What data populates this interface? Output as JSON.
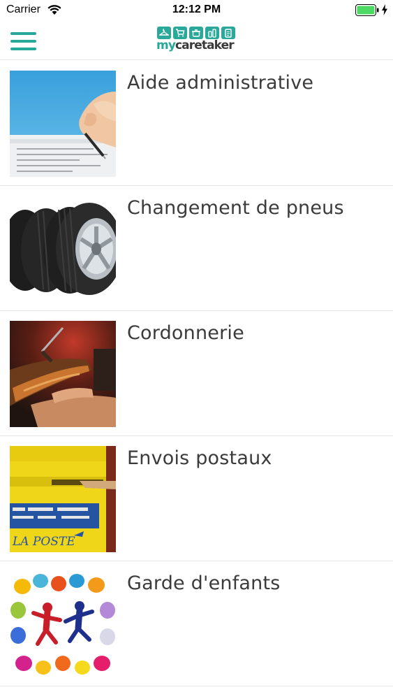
{
  "status_bar": {
    "carrier": "Carrier",
    "time": "12:12 PM",
    "wifi_icon": "wifi-icon",
    "battery_icon": "battery-icon",
    "charging_icon": "charging-bolt-icon",
    "battery_color": "#4cd964"
  },
  "nav": {
    "menu_icon": "hamburger-menu-icon",
    "logo": {
      "text_my": "my",
      "text_caretaker": "caretaker",
      "icons": [
        "hanger-icon",
        "cart-icon",
        "pot-icon",
        "bottle-icon",
        "clipboard-icon"
      ]
    }
  },
  "theme": {
    "accent": "#26a99a",
    "text": "#3b3b3b",
    "divider": "#e6e6e6"
  },
  "services": [
    {
      "title": "Aide administrative",
      "image": "hand-signing-document-photo"
    },
    {
      "title": "Changement de pneus",
      "image": "stacked-tires-photo"
    },
    {
      "title": "Cordonnerie",
      "image": "cobbler-working-shoe-photo"
    },
    {
      "title": "Envois postaux",
      "image": "la-poste-yellow-mailbox-photo"
    },
    {
      "title": "Garde d'enfants",
      "image": "colorful-handprints-children-photo"
    }
  ]
}
